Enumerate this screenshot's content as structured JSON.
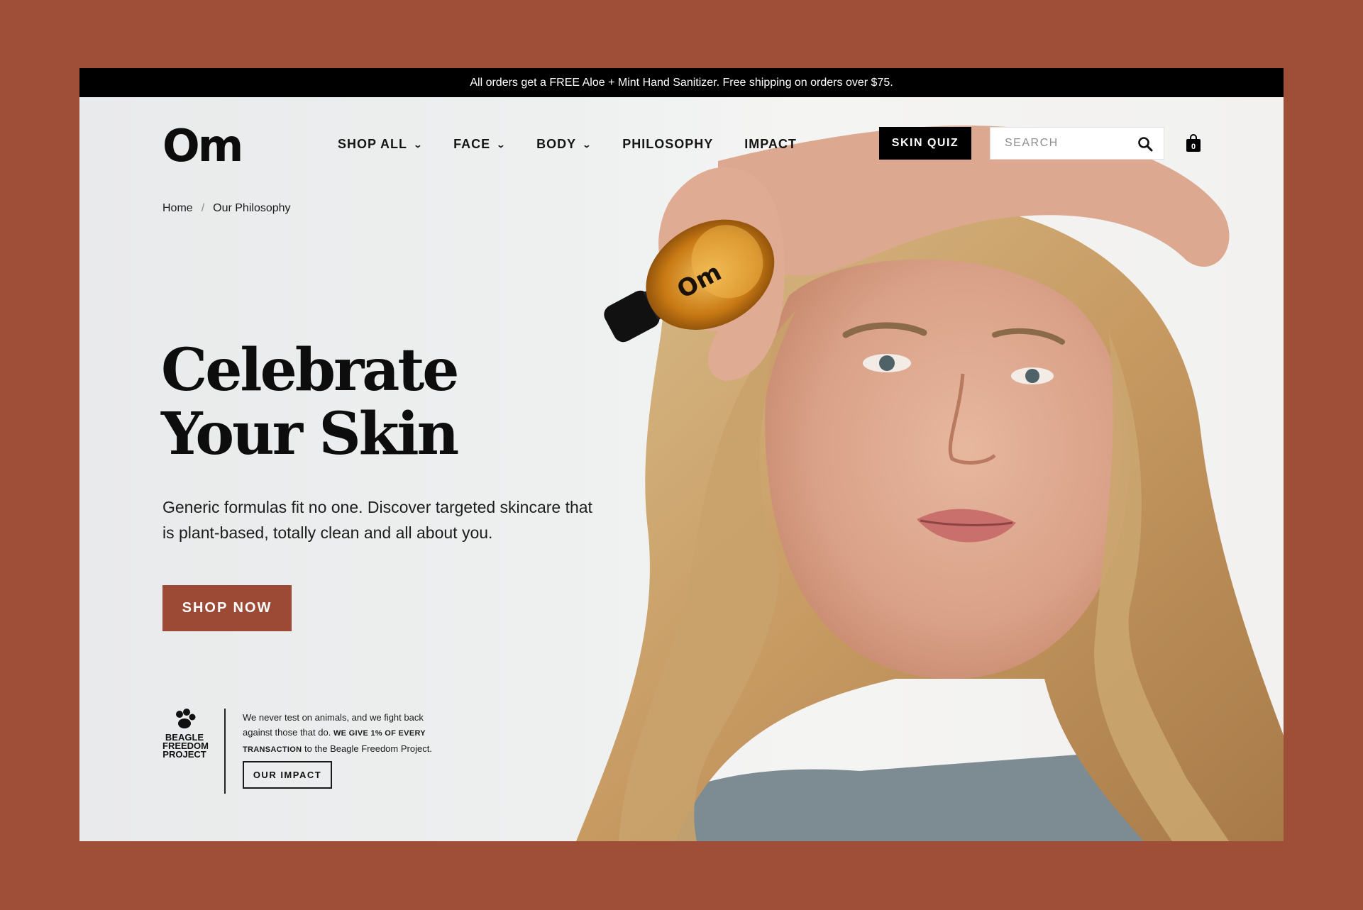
{
  "announcement": "All orders get a FREE Aloe + Mint Hand Sanitizer. Free shipping on orders over $75.",
  "brand": {
    "logo_text": "Om"
  },
  "nav": {
    "items": [
      {
        "label": "SHOP ALL",
        "dropdown": true
      },
      {
        "label": "FACE",
        "dropdown": true
      },
      {
        "label": "BODY",
        "dropdown": true
      },
      {
        "label": "PHILOSOPHY",
        "dropdown": false
      },
      {
        "label": "IMPACT",
        "dropdown": false
      }
    ],
    "chevron": "⌄",
    "skin_quiz": "SKIN QUIZ",
    "search_placeholder": "SEARCH",
    "cart_count": "0"
  },
  "breadcrumb": {
    "home": "Home",
    "separator": "/",
    "current": "Our Philosophy"
  },
  "hero": {
    "headline_line1": "Celebrate",
    "headline_line2": "Your Skin",
    "subtext": "Generic formulas fit no one. Discover targeted skincare that is plant-based, totally clean and all about you.",
    "cta": "SHOP NOW"
  },
  "beagle": {
    "logo_lines": [
      "BEAGLE",
      "FREEDOM",
      "PROJECT"
    ],
    "copy_plain": "We never test on animals, and we fight back against those that do.",
    "copy_bold": "WE GIVE 1% OF EVERY TRANSACTION",
    "copy_tail": "to the Beagle Freedom Project.",
    "button": "OUR IMPACT"
  },
  "colors": {
    "frame_bg": "#9f4e38",
    "accent": "#9c4a35",
    "black": "#000000"
  }
}
